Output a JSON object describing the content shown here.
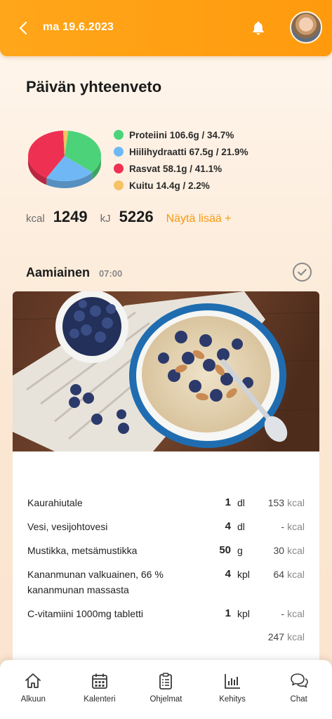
{
  "header": {
    "date": "ma 19.6.2023",
    "back_icon": "chevron-left-icon",
    "notification_icon": "bell-icon"
  },
  "summary": {
    "title": "Päivän yhteenveto",
    "macros": [
      {
        "label": "Proteiini 106.6g / 34.7%",
        "color": "#4cd37a",
        "percent": 34.7
      },
      {
        "label": "Hiilihydraatti 67.5g / 21.9%",
        "color": "#70b8f5",
        "percent": 21.9
      },
      {
        "label": "Rasvat 58.1g / 41.1%",
        "color": "#ee3153",
        "percent": 41.1
      },
      {
        "label": "Kuitu 14.4g / 2.2%",
        "color": "#f6c263",
        "percent": 2.2
      }
    ],
    "kcal_unit": "kcal",
    "kcal_value": "1249",
    "kj_unit": "kJ",
    "kj_value": "5226",
    "more_label": "Näytä lisää +"
  },
  "meal": {
    "title": "Aamiainen",
    "time": "07:00",
    "items": [
      {
        "name": "Kaurahiutale",
        "qty": "1",
        "unit": "dl",
        "kcal": "153",
        "kcal_unit": "kcal"
      },
      {
        "name": "Vesi, vesijohtovesi",
        "qty": "4",
        "unit": "dl",
        "kcal": "-",
        "kcal_unit": "kcal"
      },
      {
        "name": "Mustikka, metsämustikka",
        "qty": "50",
        "unit": "g",
        "kcal": "30",
        "kcal_unit": "kcal"
      },
      {
        "name": "Kananmunan valkuainen, 66 % kananmunan massasta",
        "qty": "4",
        "unit": "kpl",
        "kcal": "64",
        "kcal_unit": "kcal"
      },
      {
        "name": "C-vitamiini 1000mg tabletti",
        "qty": "1",
        "unit": "kpl",
        "kcal": "-",
        "kcal_unit": "kcal"
      }
    ],
    "total_kcal": "247",
    "total_unit": "kcal"
  },
  "nav": [
    {
      "label": "Alkuun",
      "icon": "home-icon"
    },
    {
      "label": "Kalenteri",
      "icon": "calendar-icon"
    },
    {
      "label": "Ohjelmat",
      "icon": "clipboard-list-icon"
    },
    {
      "label": "Kehitys",
      "icon": "bar-chart-icon"
    },
    {
      "label": "Chat",
      "icon": "chat-bubbles-icon"
    }
  ],
  "colors": {
    "accent": "#ff9f14",
    "link": "#f59a12"
  }
}
